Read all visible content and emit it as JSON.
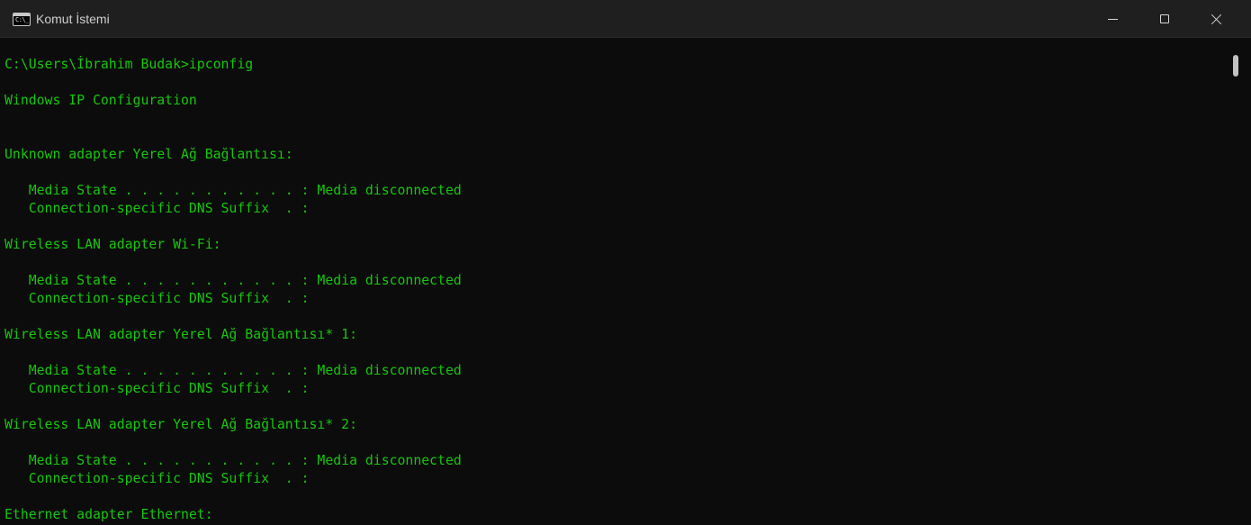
{
  "window": {
    "title": "Komut İstemi",
    "icon": "cmd-icon",
    "icon_glyph": "C:\\_",
    "controls": [
      "minimize-icon",
      "maximize-icon",
      "close-icon"
    ]
  },
  "colors": {
    "text": "#16c60c",
    "background": "#0c0c0c",
    "titlebar": "#1f1f1f"
  },
  "console": {
    "lines": [
      "C:\\Users\\İbrahim Budak>ipconfig",
      "Windows IP Configuration",
      "Unknown adapter Yerel Ağ Bağlantısı:",
      "   Media State . . . . . . . . . . . : Media disconnected",
      "   Connection-specific DNS Suffix  . :",
      "Wireless LAN adapter Wi-Fi:",
      "   Media State . . . . . . . . . . . : Media disconnected",
      "   Connection-specific DNS Suffix  . :",
      "Wireless LAN adapter Yerel Ağ Bağlantısı* 1:",
      "   Media State . . . . . . . . . . . : Media disconnected",
      "   Connection-specific DNS Suffix  . :",
      "Wireless LAN adapter Yerel Ağ Bağlantısı* 2:",
      "   Media State . . . . . . . . . . . : Media disconnected",
      "   Connection-specific DNS Suffix  . :",
      "Ethernet adapter Ethernet:"
    ]
  }
}
